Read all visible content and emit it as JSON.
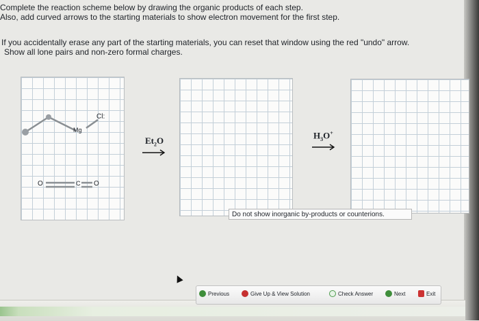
{
  "instructions": {
    "line1": "Complete the reaction scheme below by drawing the organic products of each step.",
    "line2": "Also, add curved arrows to the starting materials to show electron movement for the first step.",
    "line3": "If you accidentally erase any part of the starting materials, you can reset that window using the red \"undo\" arrow.",
    "line4": "Show all lone pairs and non-zero formal charges."
  },
  "panel1": {
    "mg_label": "Mg",
    "cl_label": "Cl:",
    "o_left": "O",
    "c_mid": "C",
    "o_right": "O"
  },
  "reagent1": {
    "base": "Et",
    "sub": "2",
    "tail": "O"
  },
  "reagent2": {
    "base": "H",
    "sub": "3",
    "tail": "O",
    "sup": "+"
  },
  "note_text": "Do not show inorganic by-products or counterions.",
  "toolbar": {
    "previous": "Previous",
    "give_up": "Give Up & View Solution",
    "check": "Check Answer",
    "next": "Next",
    "exit": "Exit"
  },
  "colors": {
    "grid": "#c3cfd8",
    "accent_green": "#3f8e3b",
    "accent_red": "#c53030"
  }
}
